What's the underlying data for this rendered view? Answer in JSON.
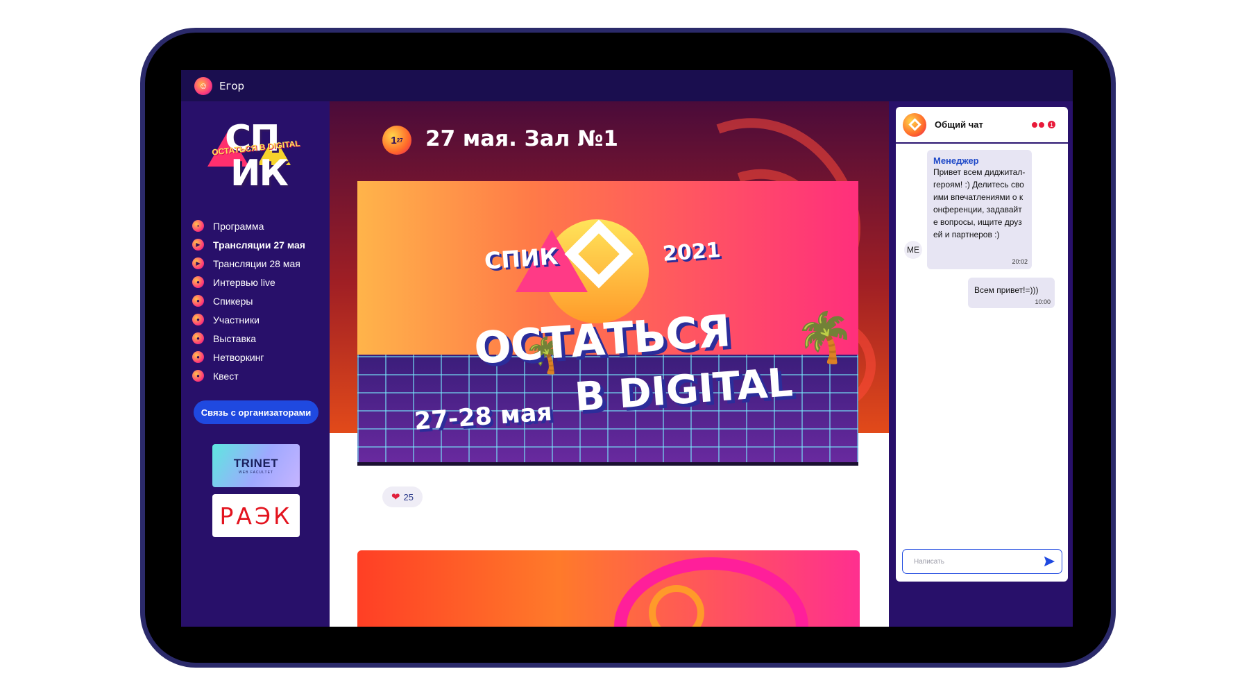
{
  "user": {
    "name": "Егор"
  },
  "sidebar": {
    "logo": {
      "line1": "СП",
      "line2": "ИК",
      "tagline": "ОСТАТЬСЯ В DIGITAL"
    },
    "menu": [
      {
        "label": "Программа",
        "icon": "program-icon",
        "active": false
      },
      {
        "label": "Трансляции 27 мая",
        "icon": "broadcast-icon",
        "active": true
      },
      {
        "label": "Трансляции 28 мая",
        "icon": "broadcast-icon",
        "active": false
      },
      {
        "label": "Интервью live",
        "icon": "interview-icon",
        "active": false
      },
      {
        "label": "Спикеры",
        "icon": "speakers-icon",
        "active": false
      },
      {
        "label": "Участники",
        "icon": "participants-icon",
        "active": false
      },
      {
        "label": "Выставка",
        "icon": "exhibition-icon",
        "active": false
      },
      {
        "label": "Нетворкинг",
        "icon": "networking-icon",
        "active": false
      },
      {
        "label": "Квест",
        "icon": "quest-icon",
        "active": false
      }
    ],
    "contact_button": "Связь с организаторами",
    "partners": {
      "trinet": {
        "name": "TRINET",
        "sub": "WEB FACULTET"
      },
      "raek": {
        "name": "РАЭК"
      }
    }
  },
  "stream": {
    "day_badge": "1",
    "day_badge_sub": "27",
    "title": "27 мая. Зал №1",
    "banner": {
      "spik": "СПИК",
      "year": "2021",
      "headline1": "ОСТАТЬСЯ",
      "headline2": "В DIGITAL",
      "dates": "27-28 мая"
    },
    "likes": "25"
  },
  "chat": {
    "title": "Общий чат",
    "unread": "1",
    "messages": [
      {
        "author": "Менеджер",
        "avatar": "МЕ",
        "text": "Привет всем диджитал-героям! :) Делитесь своими впечатлениями о конференции, задавайте вопросы, ищите друзей и партнеров :)",
        "time": "20:02"
      },
      {
        "text": "Всем привет!=)))",
        "time": "10:00"
      }
    ],
    "input_placeholder": "Написать"
  },
  "colors": {
    "frame": "#2b2a6a",
    "sidebar": "#28106a",
    "accent": "#1f49e0",
    "heart": "#e0203c"
  }
}
